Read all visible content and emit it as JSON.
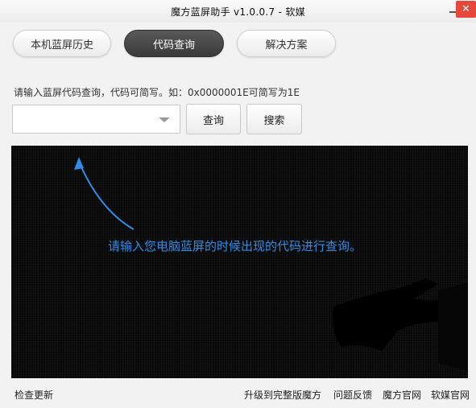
{
  "window": {
    "title": "魔方蓝屏助手 v1.0.0.7 - 软媒",
    "minimize_icon": "minimize-icon",
    "close_label": "✕"
  },
  "tabs": [
    {
      "label": "本机蓝屏历史",
      "active": false
    },
    {
      "label": "代码查询",
      "active": true
    },
    {
      "label": "解决方案",
      "active": false
    }
  ],
  "query": {
    "hint": "请输入蓝屏代码查询，代码可简写。如：0x0000001E可简写为1E",
    "input_value": "",
    "query_button": "查询",
    "search_button": "搜索"
  },
  "panel": {
    "message": "请输入您电脑蓝屏的时候出现的代码进行查询。",
    "accent_color": "#2e8de8"
  },
  "footer": {
    "check_update": "检查更新",
    "upgrade": "升级到完整版魔方",
    "feedback": "问题反馈",
    "official_site": "魔方官网",
    "ruanmei_site": "软媒官网"
  }
}
